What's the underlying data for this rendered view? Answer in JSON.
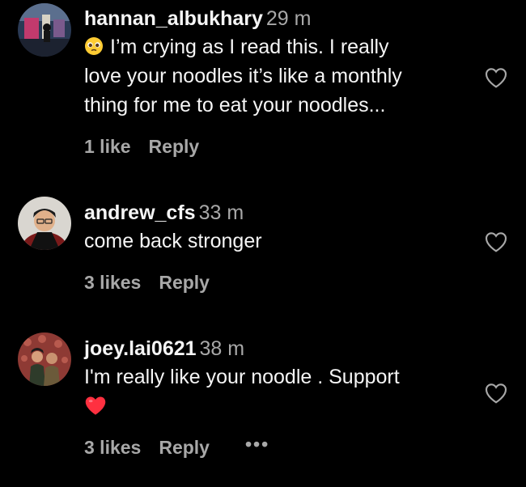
{
  "comments": [
    {
      "username": "hannan_albukhary",
      "time": "29 m",
      "emoji_icon": "pleading-face-emoji",
      "lines": [
        "I’m crying as I read this. I really",
        "love your noodles it’s like a monthly",
        "thing for me to eat your noodles..."
      ],
      "likes": "1 like",
      "reply": "Reply"
    },
    {
      "username": "andrew_cfs",
      "time": "33 m",
      "lines": [
        "come back stronger"
      ],
      "likes": "3 likes",
      "reply": "Reply"
    },
    {
      "username": "joey.lai0621",
      "time": "38 m",
      "lines": [
        "I'm really like your noodle . Support"
      ],
      "emoji_icon": "red-heart-emoji",
      "likes": "3 likes",
      "reply": "Reply",
      "more": "•••"
    }
  ],
  "icons": {
    "like": "heart-outline-icon"
  },
  "colors": {
    "background": "#000000",
    "primary_text": "#f5f5f5",
    "secondary_text": "#a8a8a8",
    "heart_red": "#ff3040"
  }
}
